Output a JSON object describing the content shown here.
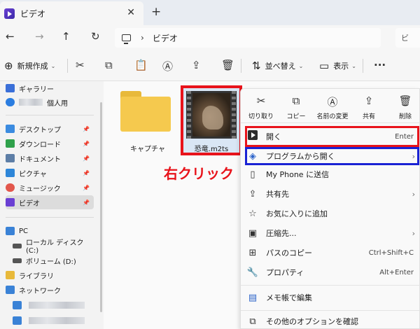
{
  "tab": {
    "title": "ビデオ",
    "close": "✕",
    "new_tab": "+"
  },
  "nav": {
    "back": "←",
    "forward": "→",
    "up": "↑",
    "refresh": "↻",
    "separator": "›",
    "location": "ビデオ",
    "search_placeholder": "ビ"
  },
  "commandbar": {
    "new_label": "新規作成",
    "sort_label": "並べ替え",
    "view_label": "表示",
    "more": "···"
  },
  "sidebar": {
    "items": [
      {
        "label": "ギャラリー",
        "icon": "gallery-icon",
        "color": "#3a6fd8"
      },
      {
        "label": "個人用",
        "icon": "onedrive-icon",
        "color": "#2b7de0"
      },
      {
        "label": "デスクトップ",
        "icon": "desktop-icon",
        "color": "#3b8be0",
        "pinned": true
      },
      {
        "label": "ダウンロード",
        "icon": "download-icon",
        "color": "#2fa14b",
        "pinned": true
      },
      {
        "label": "ドキュメント",
        "icon": "documents-icon",
        "color": "#5d7ea6",
        "pinned": true
      },
      {
        "label": "ピクチャ",
        "icon": "pictures-icon",
        "color": "#2e86d8",
        "pinned": true
      },
      {
        "label": "ミュージック",
        "icon": "music-icon",
        "color": "#e2574c",
        "pinned": true
      },
      {
        "label": "ビデオ",
        "icon": "videos-icon",
        "color": "#6a3fd3",
        "pinned": true,
        "selected": true
      },
      {
        "label": "PC",
        "icon": "pc-icon",
        "color": "#3a82d6"
      },
      {
        "label": "ローカル ディスク (C:)",
        "icon": "drive-icon",
        "color": "#555555"
      },
      {
        "label": "ボリューム (D:)",
        "icon": "drive-icon",
        "color": "#555555"
      },
      {
        "label": "ライブラリ",
        "icon": "library-icon",
        "color": "#e8b93a"
      },
      {
        "label": "ネットワーク",
        "icon": "network-icon",
        "color": "#3a82d6"
      }
    ],
    "pin_glyph": "📌"
  },
  "files": [
    {
      "name": "キャプチャ",
      "type": "folder"
    },
    {
      "name": "恐竜.m2ts",
      "type": "video"
    }
  ],
  "annotation": {
    "right_click": "右クリック",
    "color": "#e8131b"
  },
  "context_menu": {
    "quick_actions": [
      {
        "label": "切り取り",
        "icon": "cut-icon",
        "glyph": "✂"
      },
      {
        "label": "コピー",
        "icon": "copy-icon",
        "glyph": "⧉"
      },
      {
        "label": "名前の変更",
        "icon": "rename-icon",
        "glyph": "Ⓐ"
      },
      {
        "label": "共有",
        "icon": "share-icon",
        "glyph": "⇪"
      },
      {
        "label": "削除",
        "icon": "delete-icon",
        "glyph": "🗑"
      }
    ],
    "items": [
      {
        "label": "開く",
        "shortcut": "Enter"
      },
      {
        "label": "プログラムから開く",
        "submenu": "›"
      },
      {
        "label": "My Phone に送信"
      },
      {
        "label": "共有先",
        "submenu": "›"
      },
      {
        "label": "お気に入りに追加"
      },
      {
        "label": "圧縮先...",
        "submenu": "›"
      },
      {
        "label": "パスのコピー",
        "shortcut": "Ctrl+Shift+C"
      },
      {
        "label": "プロパティ",
        "shortcut": "Alt+Enter"
      },
      {
        "label": "メモ帳で編集"
      },
      {
        "label": "その他のオプションを確認"
      }
    ]
  },
  "highlight_colors": {
    "open": "#e8131b",
    "open_with": "#1a22d4"
  }
}
